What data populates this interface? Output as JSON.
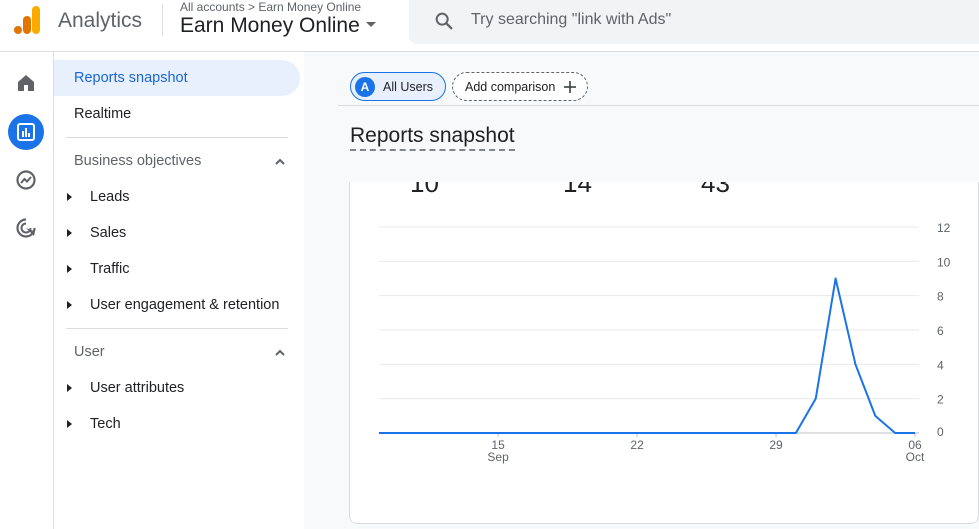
{
  "header": {
    "app_name": "Analytics",
    "breadcrumb": "All accounts > Earn Money Online",
    "account_name": "Earn Money Online",
    "search_placeholder": "Try searching \"link with Ads\""
  },
  "nav": {
    "items": [
      {
        "label": "Reports snapshot",
        "selected": true
      },
      {
        "label": "Realtime"
      }
    ],
    "sections": [
      {
        "title": "Business objectives",
        "items": [
          "Leads",
          "Sales",
          "Traffic",
          "User engagement & retention"
        ]
      },
      {
        "title": "User",
        "items": [
          "User attributes",
          "Tech"
        ]
      }
    ]
  },
  "main": {
    "comparison_chip": {
      "avatar": "A",
      "label": "All Users"
    },
    "add_comparison": "Add comparison",
    "title": "Reports snapshot",
    "metrics": [
      "10",
      "14",
      "43"
    ]
  },
  "chart_data": {
    "type": "line",
    "x_ticks": [
      {
        "day": "15",
        "month": "Sep"
      },
      {
        "day": "22",
        "month": ""
      },
      {
        "day": "29",
        "month": ""
      },
      {
        "day": "06",
        "month": "Oct"
      }
    ],
    "y_ticks": [
      "12",
      "10",
      "8",
      "6",
      "4",
      "2",
      "0"
    ],
    "ylim": [
      0,
      12
    ],
    "series": [
      {
        "color": "#1a73e8",
        "x": [
          "Sep 9",
          "Sep 10",
          "Sep 11",
          "Sep 12",
          "Sep 13",
          "Sep 14",
          "Sep 15",
          "Sep 16",
          "Sep 17",
          "Sep 18",
          "Sep 19",
          "Sep 20",
          "Sep 21",
          "Sep 22",
          "Sep 23",
          "Sep 24",
          "Sep 25",
          "Sep 26",
          "Sep 27",
          "Sep 28",
          "Sep 29",
          "Sep 30",
          "Oct 1",
          "Oct 2",
          "Oct 3",
          "Oct 4",
          "Oct 5",
          "Oct 6"
        ],
        "values": [
          0,
          0,
          0,
          0,
          0,
          0,
          0,
          0,
          0,
          0,
          0,
          0,
          0,
          0,
          0,
          0,
          0,
          0,
          0,
          0,
          0,
          0,
          2,
          9,
          4,
          1,
          0,
          0
        ]
      }
    ]
  },
  "colors": {
    "accent": "#1a73e8",
    "selected_bg": "#e8f0fe"
  }
}
